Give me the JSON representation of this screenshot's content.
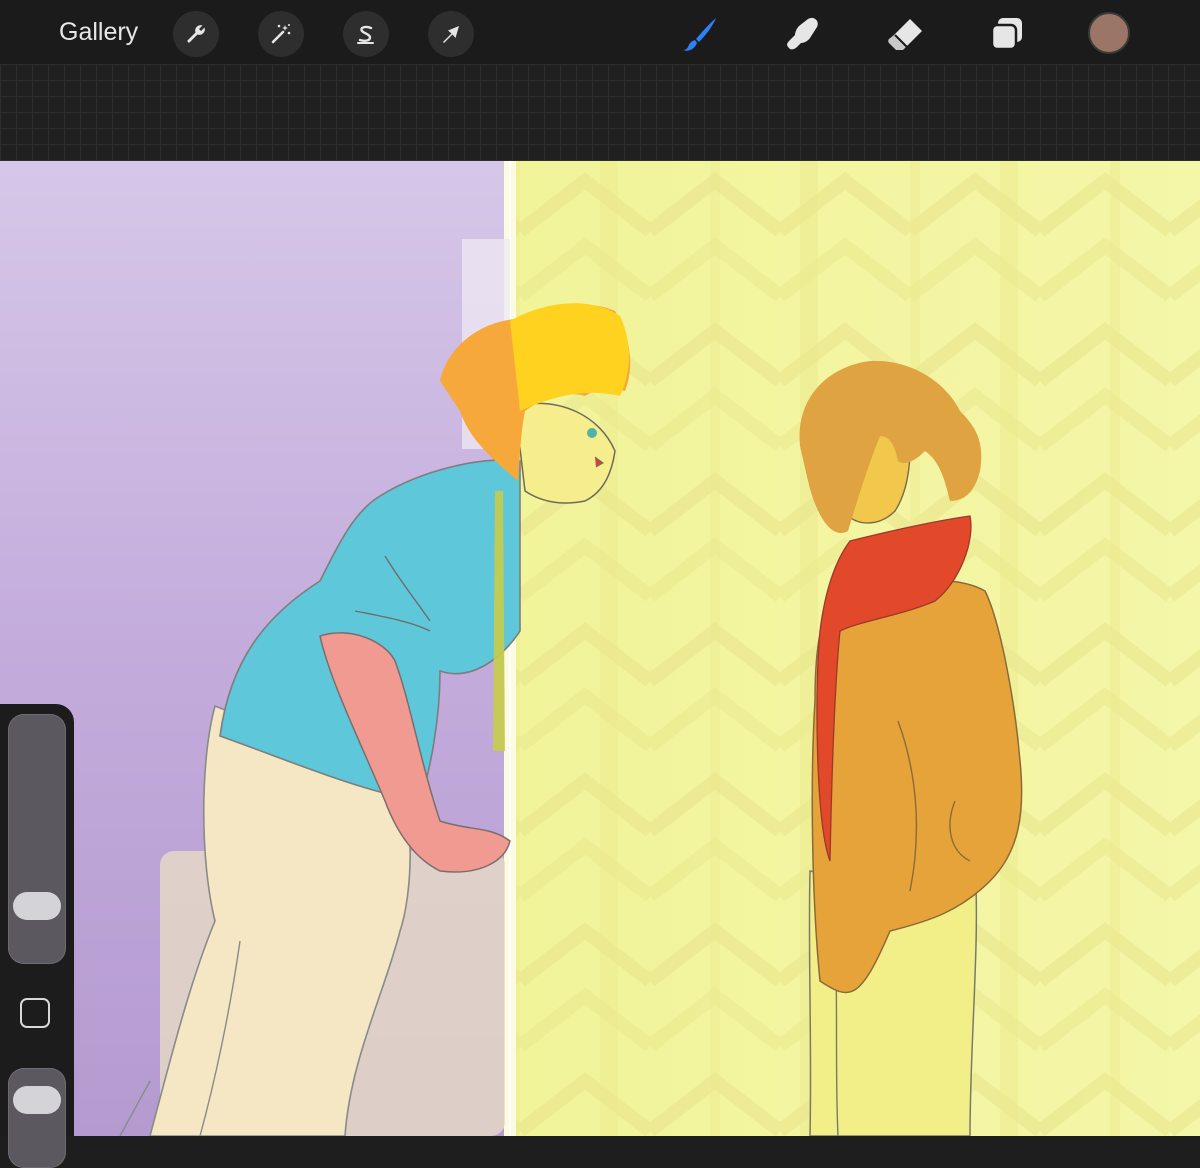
{
  "topbar": {
    "gallery_label": "Gallery",
    "left_tools": [
      {
        "name": "actions",
        "icon": "wrench-icon"
      },
      {
        "name": "adjustments",
        "icon": "magic-wand-icon"
      },
      {
        "name": "selection",
        "icon": "selection-s-icon"
      },
      {
        "name": "transform",
        "icon": "arrow-cursor-icon"
      }
    ],
    "right_tools": [
      {
        "name": "brush",
        "icon": "brush-icon",
        "active": true
      },
      {
        "name": "smudge",
        "icon": "smudge-finger-icon",
        "active": false
      },
      {
        "name": "eraser",
        "icon": "eraser-icon",
        "active": false
      },
      {
        "name": "layers",
        "icon": "layers-icon",
        "active": false
      }
    ],
    "current_color": "#9b7566"
  },
  "colors": {
    "active_tool": "#2f7ff5",
    "inactive_tool": "#e6e6e6"
  },
  "sidebar": {
    "brush_size_level": 0.18,
    "brush_opacity_level": 0.8
  }
}
